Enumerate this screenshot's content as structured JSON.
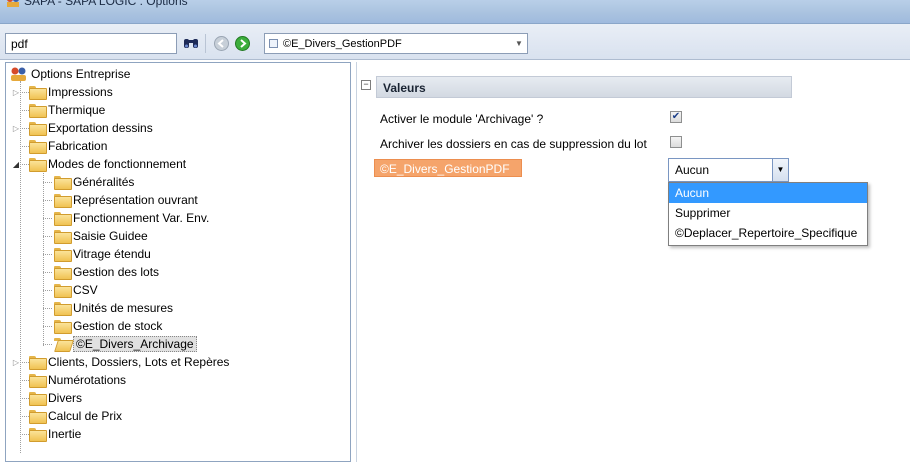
{
  "window": {
    "title": "SAPA - SAPA LOGIC : Options",
    "icon": "app-people-icon"
  },
  "toolbar": {
    "search_value": "pdf",
    "path_value": "©E_Divers_GestionPDF",
    "icons": [
      "binoculars-icon",
      "back-arrow-icon",
      "forward-arrow-icon"
    ]
  },
  "tree": {
    "root": "Options Entreprise",
    "items": [
      {
        "label": "Impressions"
      },
      {
        "label": "Thermique"
      },
      {
        "label": "Exportation dessins"
      },
      {
        "label": "Fabrication"
      },
      {
        "label": "Modes de fonctionnement"
      },
      {
        "label": "Généralités"
      },
      {
        "label": "Représentation ouvrant"
      },
      {
        "label": "Fonctionnement Var. Env."
      },
      {
        "label": "Saisie Guidee"
      },
      {
        "label": "Vitrage étendu"
      },
      {
        "label": "Gestion des lots"
      },
      {
        "label": "CSV"
      },
      {
        "label": "Unités de mesures"
      },
      {
        "label": "Gestion de stock"
      },
      {
        "label": "©E_Divers_Archivage"
      },
      {
        "label": "Clients, Dossiers, Lots et Repères"
      },
      {
        "label": "Numérotations"
      },
      {
        "label": "Divers"
      },
      {
        "label": "Calcul de Prix"
      },
      {
        "label": "Inertie"
      }
    ]
  },
  "props": {
    "category": "Valeurs",
    "activer_label": "Activer le module 'Archivage' ?",
    "activer_checked": true,
    "archiver_label": "Archiver les dossiers en cas de suppression du lot",
    "archiver_checked": false,
    "gestion_label": "©E_Divers_GestionPDF",
    "gestion_value": "Aucun",
    "options": [
      "Aucun",
      "Supprimer",
      "©Deplacer_Repertoire_Specifique"
    ]
  },
  "colors": {
    "highlight": "#f5a46b",
    "selection": "#3399ff"
  }
}
